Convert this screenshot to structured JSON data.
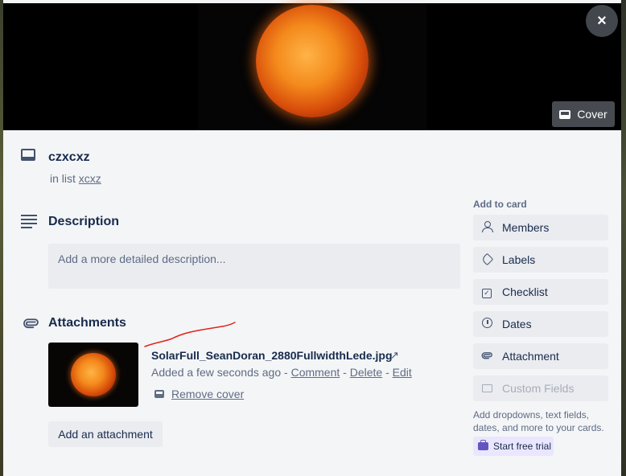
{
  "cover": {
    "image_name": "sun-image",
    "close_icon": "×",
    "cover_button_label": "Cover"
  },
  "card": {
    "title": "czxcxz",
    "in_list_prefix": "in list",
    "list_name": "xcxz"
  },
  "description": {
    "title": "Description",
    "placeholder": "Add a more detailed description..."
  },
  "attachments": {
    "title": "Attachments",
    "items": [
      {
        "file_name": "SolarFull_SeanDoran_2880FullwidthLede.jpg",
        "open_icon": "↗",
        "added": "Added a few seconds ago",
        "sep": "-",
        "comment_label": "Comment",
        "delete_label": "Delete",
        "edit_label": "Edit",
        "remove_cover_label": "Remove cover"
      }
    ],
    "add_button_label": "Add an attachment"
  },
  "sidebar": {
    "heading": "Add to card",
    "buttons": [
      {
        "label": "Members",
        "icon": "member-icon"
      },
      {
        "label": "Labels",
        "icon": "label-icon"
      },
      {
        "label": "Checklist",
        "icon": "checklist-icon"
      },
      {
        "label": "Dates",
        "icon": "clock-icon"
      },
      {
        "label": "Attachment",
        "icon": "paperclip-icon"
      },
      {
        "label": "Custom Fields",
        "icon": "custom-fields-icon",
        "disabled": true
      }
    ],
    "upsell_text": "Add dropdowns, text fields, dates, and more to your cards.",
    "trial_label": "Start free trial"
  },
  "colors": {
    "annotation_stroke": "#e2231a",
    "trial_accent": "#6554c0"
  }
}
